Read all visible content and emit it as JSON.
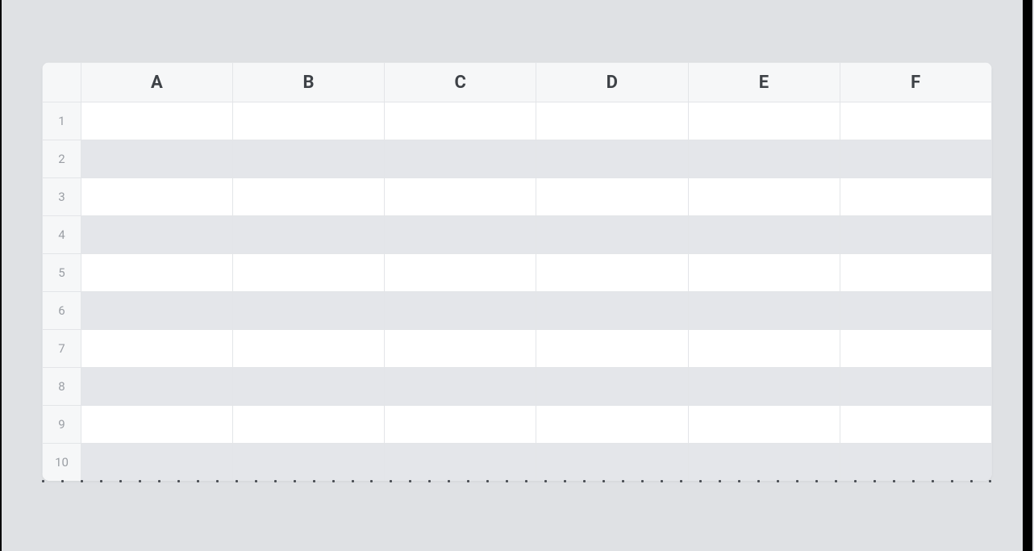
{
  "spreadsheet": {
    "columns": [
      "A",
      "B",
      "C",
      "D",
      "E",
      "F"
    ],
    "rows": [
      "1",
      "2",
      "3",
      "4",
      "5",
      "6",
      "7",
      "8",
      "9",
      "10"
    ],
    "cells": {
      "A1": "",
      "B1": "",
      "C1": "",
      "D1": "",
      "E1": "",
      "F1": "",
      "A2": "",
      "B2": "",
      "C2": "",
      "D2": "",
      "E2": "",
      "F2": "",
      "A3": "",
      "B3": "",
      "C3": "",
      "D3": "",
      "E3": "",
      "F3": "",
      "A4": "",
      "B4": "",
      "C4": "",
      "D4": "",
      "E4": "",
      "F4": "",
      "A5": "",
      "B5": "",
      "C5": "",
      "D5": "",
      "E5": "",
      "F5": "",
      "A6": "",
      "B6": "",
      "C6": "",
      "D6": "",
      "E6": "",
      "F6": "",
      "A7": "",
      "B7": "",
      "C7": "",
      "D7": "",
      "E7": "",
      "F7": "",
      "A8": "",
      "B8": "",
      "C8": "",
      "D8": "",
      "E8": "",
      "F8": "",
      "A9": "",
      "B9": "",
      "C9": "",
      "D9": "",
      "E9": "",
      "F9": "",
      "A10": "",
      "B10": "",
      "C10": "",
      "D10": "",
      "E10": "",
      "F10": ""
    }
  }
}
